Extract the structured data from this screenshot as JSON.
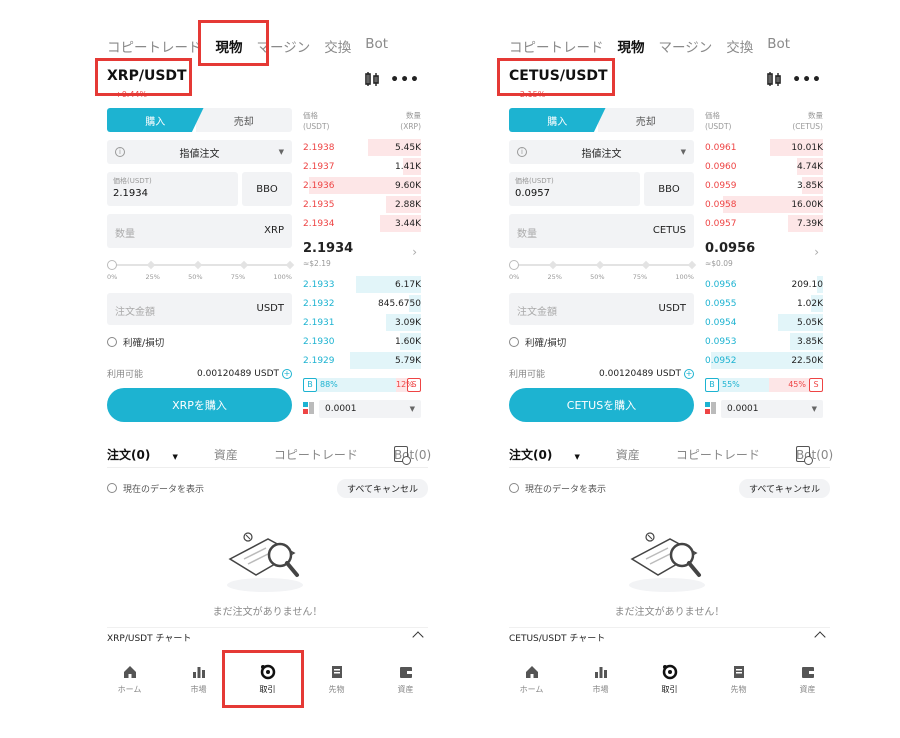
{
  "colors": {
    "accent": "#1db3d1",
    "sell": "#e44444",
    "highlight": "#e53935"
  },
  "phones": [
    {
      "topnav": [
        "コピートレード",
        "現物",
        "マージン",
        "交換",
        "Bot"
      ],
      "pair": "XRP/USDT",
      "change": "+0.44%",
      "buy_label": "購入",
      "sell_label": "売却",
      "order_type": "指値注文",
      "price_label": "価格(USDT)",
      "price_value": "2.1934",
      "bbo": "BBO",
      "qty_placeholder": "数量",
      "qty_unit": "XRP",
      "percents": [
        "0%",
        "25%",
        "50%",
        "75%",
        "100%"
      ],
      "amount_placeholder": "注文金額",
      "amount_unit": "USDT",
      "tpsl": "利確/損切",
      "available_label": "利用可能",
      "available_value": "0.00120489 USDT",
      "buy_button": "XRPを購入",
      "book_hdr_price": [
        "価格",
        "(USDT)"
      ],
      "book_hdr_qty": [
        "数量",
        "(XRP)"
      ],
      "asks": [
        {
          "p": "2.1938",
          "q": "5.45K",
          "w": 0.45
        },
        {
          "p": "2.1937",
          "q": "1.41K",
          "w": 0.15
        },
        {
          "p": "2.1936",
          "q": "9.60K",
          "w": 0.95
        },
        {
          "p": "2.1935",
          "q": "2.88K",
          "w": 0.3
        },
        {
          "p": "2.1934",
          "q": "3.44K",
          "w": 0.35
        }
      ],
      "last": "2.1934",
      "last_usd": "≈$2.19",
      "bids": [
        {
          "p": "2.1933",
          "q": "6.17K",
          "w": 0.55
        },
        {
          "p": "2.1932",
          "q": "845.6750",
          "w": 0.1
        },
        {
          "p": "2.1931",
          "q": "3.09K",
          "w": 0.3
        },
        {
          "p": "2.1930",
          "q": "1.60K",
          "w": 0.18
        },
        {
          "p": "2.1929",
          "q": "5.79K",
          "w": 0.6
        }
      ],
      "ratio_b_label": "B",
      "ratio_b": "88%",
      "ratio_b_frac": 0.88,
      "ratio_s": "12%",
      "ratio_s_label": "S",
      "depth": "0.0001",
      "tabs": [
        "注文(0)",
        "資産",
        "コピートレード",
        "Bot(0)"
      ],
      "show_current": "現在のデータを表示",
      "cancel_all": "すべてキャンセル",
      "empty": "まだ注文がありません！",
      "chart_label": "XRP/USDT チャート",
      "nav": [
        "ホーム",
        "市場",
        "取引",
        "先物",
        "資産"
      ]
    },
    {
      "topnav": [
        "コピートレード",
        "現物",
        "マージン",
        "交換",
        "Bot"
      ],
      "pair": "CETUS/USDT",
      "change": "-2.15%",
      "buy_label": "購入",
      "sell_label": "売却",
      "order_type": "指値注文",
      "price_label": "価格(USDT)",
      "price_value": "0.0957",
      "bbo": "BBO",
      "qty_placeholder": "数量",
      "qty_unit": "CETUS",
      "percents": [
        "0%",
        "25%",
        "50%",
        "75%",
        "100%"
      ],
      "amount_placeholder": "注文金額",
      "amount_unit": "USDT",
      "tpsl": "利確/損切",
      "available_label": "利用可能",
      "available_value": "0.00120489 USDT",
      "buy_button": "CETUSを購入",
      "book_hdr_price": [
        "価格",
        "(USDT)"
      ],
      "book_hdr_qty": [
        "数量",
        "(CETUS)"
      ],
      "asks": [
        {
          "p": "0.0961",
          "q": "10.01K",
          "w": 0.45
        },
        {
          "p": "0.0960",
          "q": "4.74K",
          "w": 0.22
        },
        {
          "p": "0.0959",
          "q": "3.85K",
          "w": 0.18
        },
        {
          "p": "0.0958",
          "q": "16.00K",
          "w": 0.85
        },
        {
          "p": "0.0957",
          "q": "7.39K",
          "w": 0.3
        }
      ],
      "last": "0.0956",
      "last_usd": "≈$0.09",
      "bids": [
        {
          "p": "0.0956",
          "q": "209.10",
          "w": 0.05
        },
        {
          "p": "0.0955",
          "q": "1.02K",
          "w": 0.1
        },
        {
          "p": "0.0954",
          "q": "5.05K",
          "w": 0.38
        },
        {
          "p": "0.0953",
          "q": "3.85K",
          "w": 0.28
        },
        {
          "p": "0.0952",
          "q": "22.50K",
          "w": 0.95
        }
      ],
      "ratio_b_label": "B",
      "ratio_b": "55%",
      "ratio_b_frac": 0.55,
      "ratio_s": "45%",
      "ratio_s_label": "S",
      "depth": "0.0001",
      "tabs": [
        "注文(0)",
        "資産",
        "コピートレード",
        "Bot(0)"
      ],
      "show_current": "現在のデータを表示",
      "cancel_all": "すべてキャンセル",
      "empty": "まだ注文がありません！",
      "chart_label": "CETUS/USDT チャート",
      "nav": [
        "ホーム",
        "市場",
        "取引",
        "先物",
        "資産"
      ]
    }
  ]
}
